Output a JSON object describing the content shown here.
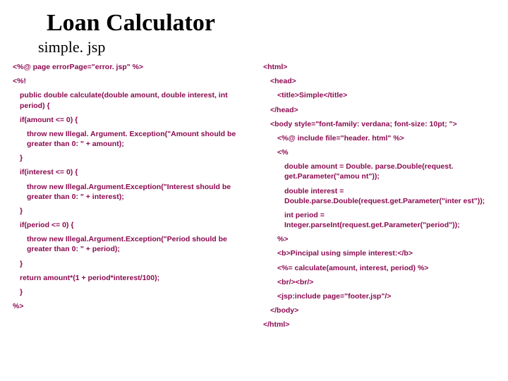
{
  "title": "Loan Calculator",
  "subtitle": "simple. jsp",
  "left": {
    "l0": "<%@ page errorPage=\"error. jsp\" %>",
    "l1": "<%!",
    "l2": "public double calculate(double amount, double interest, int period) {",
    "l3": "if(amount <= 0) {",
    "l4": "throw new Illegal. Argument. Exception(\"Amount should be greater than 0: \" + amount);",
    "l5": "}",
    "l6": "if(interest <= 0) {",
    "l7": "throw new Illegal.Argument.Exception(\"Interest should be greater than 0: \" + interest);",
    "l8": "}",
    "l9": "if(period <= 0) {",
    "l10": "throw new Illegal.Argument.Exception(\"Period should be greater than 0: \" + period);",
    "l11": "}",
    "l12": "return amount*(1 + period*interest/100);",
    "l13": "}",
    "l14": "%>"
  },
  "right": {
    "r0": "<html>",
    "r1": "<head>",
    "r2": "<title>Simple</title>",
    "r3": "</head>",
    "r4": "<body style=\"font-family: verdana; font-size: 10pt; \">",
    "r5": "<%@ include file=\"header. html\" %>",
    "r6": "<%",
    "r7": "double amount = Double. parse.Double(request. get.Parameter(\"amou nt\"));",
    "r8": "double interest = Double.parse.Double(request.get.Parameter(\"inter est\"));",
    "r9": "int period = Integer.parseInt(request.get.Parameter(\"period\"));",
    "r10": "%>",
    "r11": "<b>Pincipal using simple interest:</b>",
    "r12": "<%= calculate(amount, interest, period) %>",
    "r13": "<br/><br/>",
    "r14": "<jsp:include page=\"footer.jsp\"/>",
    "r15": "</body>",
    "r16": "</html>"
  }
}
